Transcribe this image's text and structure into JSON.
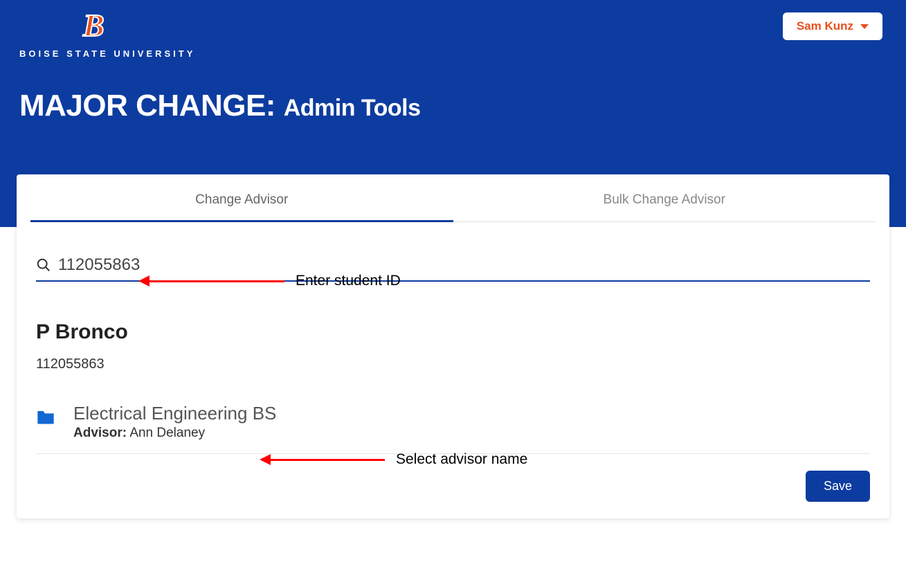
{
  "brand": {
    "letter": "B",
    "name": "BOISE STATE UNIVERSITY"
  },
  "user": {
    "name": "Sam Kunz"
  },
  "title": {
    "main": "MAJOR CHANGE:",
    "sub": "Admin Tools"
  },
  "tabs": {
    "change": "Change Advisor",
    "bulk": "Bulk Change Advisor"
  },
  "search": {
    "value": "112055863"
  },
  "student": {
    "name": "P Bronco",
    "id": "112055863",
    "major": "Electrical Engineering BS",
    "advisor_label": "Advisor:",
    "advisor_name": "Ann Delaney"
  },
  "buttons": {
    "save": "Save"
  },
  "annotations": {
    "enter_id": "Enter student ID",
    "select_advisor": "Select advisor name"
  }
}
